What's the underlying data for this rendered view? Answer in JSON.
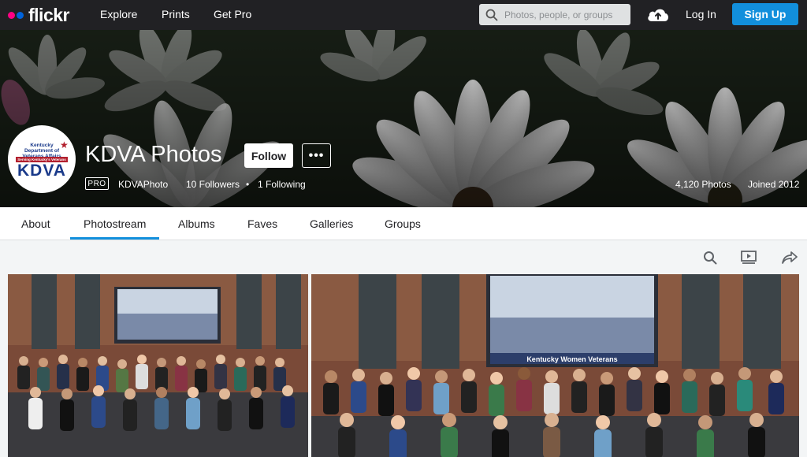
{
  "brand": {
    "name": "flickr",
    "dot_colors": [
      "#ff0084",
      "#0063dc"
    ]
  },
  "nav": {
    "explore": "Explore",
    "prints": "Prints",
    "get_pro": "Get Pro"
  },
  "search": {
    "placeholder": "Photos, people, or groups"
  },
  "auth": {
    "login": "Log In",
    "signup": "Sign Up"
  },
  "profile": {
    "avatar_org": "Kentucky Department of Veterans Affairs",
    "avatar_tagline": "Serving Kentucky's Veterans",
    "avatar_mark": "KDVA",
    "title": "KDVA Photos",
    "follow_label": "Follow",
    "more_label": "•••",
    "pro_badge": "PRO",
    "username": "KDVAPhoto",
    "followers": "10 Followers",
    "separator": "•",
    "following": "1 Following",
    "photos_count": "4,120 Photos",
    "joined": "Joined 2012"
  },
  "tabs": [
    {
      "label": "About"
    },
    {
      "label": "Photostream",
      "active": true
    },
    {
      "label": "Albums"
    },
    {
      "label": "Faves"
    },
    {
      "label": "Galleries"
    },
    {
      "label": "Groups"
    }
  ],
  "toolbar_icons": [
    "search-icon",
    "slideshow-icon",
    "share-icon"
  ],
  "photos": [
    {
      "screen_text": ""
    },
    {
      "screen_text": "Kentucky Women Veterans"
    }
  ],
  "colors": {
    "accent": "#128fdc",
    "topbar": "#212124"
  }
}
